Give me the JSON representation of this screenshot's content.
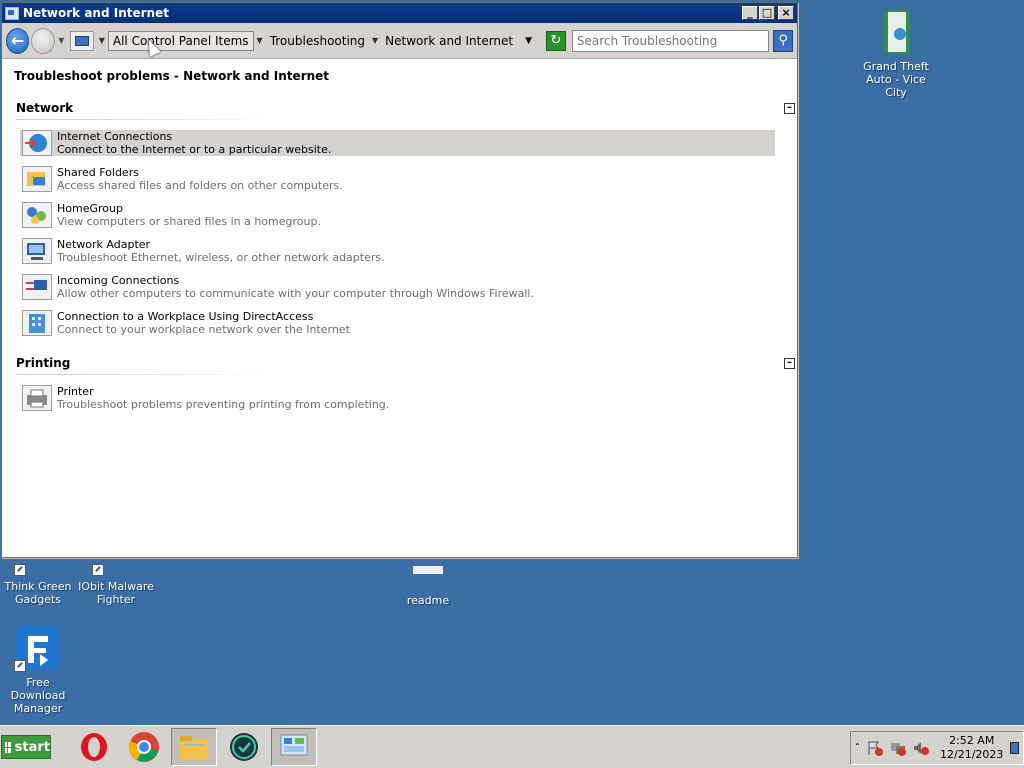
{
  "window": {
    "title": "Network and Internet",
    "controls": {
      "minimize": "_",
      "maximize": "□",
      "close": "×"
    }
  },
  "toolbar": {
    "breadcrumbs": [
      "All Control Panel Items",
      "Troubleshooting",
      "Network and Internet"
    ],
    "search_placeholder": "Search Troubleshooting"
  },
  "content": {
    "page_title": "Troubleshoot problems - Network and Internet",
    "groups": [
      {
        "name": "Network",
        "items": [
          {
            "title": "Internet Connections",
            "desc": "Connect to the Internet or to a particular website.",
            "icon": "globe-network-icon"
          },
          {
            "title": "Shared Folders",
            "desc": "Access shared files and folders on other computers.",
            "icon": "shared-folder-icon"
          },
          {
            "title": "HomeGroup",
            "desc": "View computers or shared files in a homegroup.",
            "icon": "homegroup-icon"
          },
          {
            "title": "Network Adapter",
            "desc": "Troubleshoot Ethernet, wireless, or other network adapters.",
            "icon": "network-adapter-icon"
          },
          {
            "title": "Incoming Connections",
            "desc": "Allow other computers to communicate with your computer through Windows Firewall.",
            "icon": "incoming-connections-icon"
          },
          {
            "title": "Connection to a Workplace Using DirectAccess",
            "desc": "Connect to your workplace network over the Internet",
            "icon": "workplace-icon"
          }
        ]
      },
      {
        "name": "Printing",
        "items": [
          {
            "title": "Printer",
            "desc": "Troubleshoot problems preventing printing from completing.",
            "icon": "printer-icon"
          }
        ]
      }
    ]
  },
  "desktop": {
    "icons": [
      {
        "label": "Grand Theft Auto - Vice City"
      },
      {
        "label": "Think Green Gadgets"
      },
      {
        "label": "IObit Malware Fighter"
      },
      {
        "label": "readme"
      },
      {
        "label": "Free Download Manager"
      }
    ]
  },
  "taskbar": {
    "start_label": "start",
    "clock_time": "2:52 AM",
    "clock_date": "12/21/2023"
  }
}
